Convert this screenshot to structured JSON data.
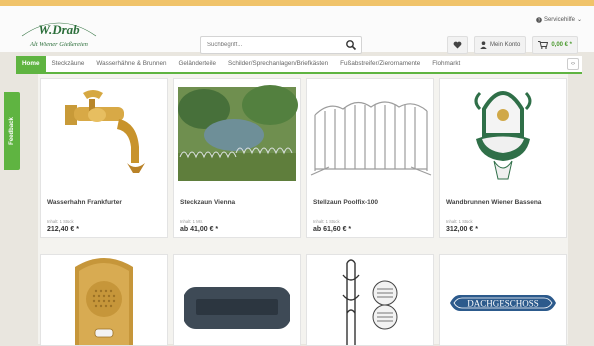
{
  "brand": {
    "logo_line1": "W.Drab",
    "logo_line2": "Alt Wiener Gießereien"
  },
  "service": {
    "label": "Servicehilfe"
  },
  "search": {
    "placeholder": "Suchbegriff..."
  },
  "header_actions": {
    "account_label": "Mein Konto",
    "cart_total": "0,00 € *"
  },
  "nav": {
    "items": [
      {
        "label": "Home",
        "active": true
      },
      {
        "label": "Steckzäune",
        "active": false
      },
      {
        "label": "Wasserhähne & Brunnen",
        "active": false
      },
      {
        "label": "Geländerteile",
        "active": false
      },
      {
        "label": "Schilder/Sprechanlagen/Briefkästen",
        "active": false
      },
      {
        "label": "Fußabstreifer/Zierornamente",
        "active": false
      },
      {
        "label": "Flohmarkt",
        "active": false
      }
    ]
  },
  "feedback_label": "Feedback",
  "products": [
    {
      "title": "Wasserhahn Frankfurter",
      "inhalt": "Inhalt: 1 Stück",
      "price": "212,40 € *",
      "icon": "faucet-image"
    },
    {
      "title": "Steckzaun Vienna",
      "inhalt": "Inhalt: 1 Mtr.",
      "price": "ab 41,00 € *",
      "icon": "garden-fence-image"
    },
    {
      "title": "Stellzaun Poolfix-100",
      "inhalt": "Inhalt: 1 Stück",
      "price": "ab 61,60 € *",
      "icon": "fence-panel-image"
    },
    {
      "title": "Wandbrunnen Wiener Bassena",
      "inhalt": "Inhalt: 1 Stück",
      "price": "312,00 € *",
      "icon": "wall-fountain-image"
    },
    {
      "title": "",
      "inhalt": "",
      "price": "",
      "icon": "intercom-plate-image"
    },
    {
      "title": "",
      "inhalt": "",
      "price": "",
      "icon": "mailbox-slot-image"
    },
    {
      "title": "",
      "inhalt": "",
      "price": "",
      "icon": "ornament-image"
    },
    {
      "title": "",
      "inhalt": "",
      "price": "",
      "icon": "sign-image",
      "sign_text": "DACHGESCHOSS"
    }
  ],
  "colors": {
    "accent_green": "#5fb441",
    "top_band": "#f0c36a",
    "logo_green": "#2b6e3a"
  }
}
